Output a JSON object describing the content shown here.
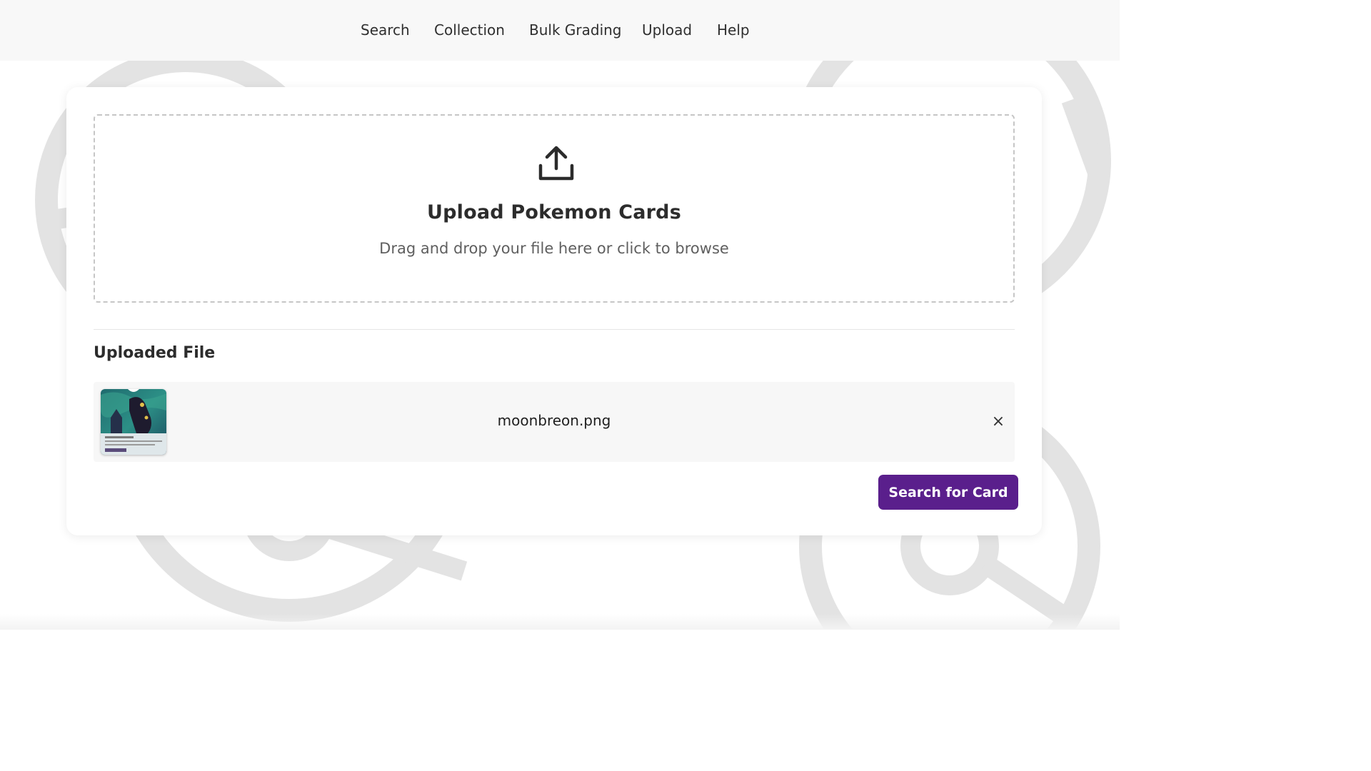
{
  "nav": {
    "items": [
      {
        "label": "Search"
      },
      {
        "label": "Collection"
      },
      {
        "label": "Bulk Grading"
      },
      {
        "label": "Upload"
      },
      {
        "label": "Help"
      }
    ]
  },
  "dropzone": {
    "icon": "upload-icon",
    "title": "Upload Pokemon Cards",
    "subtitle": "Drag and drop your file here or click to browse"
  },
  "uploaded": {
    "section_title": "Uploaded File",
    "file_name": "moonbreon.png",
    "remove_icon": "close-icon",
    "remove_label": "×"
  },
  "actions": {
    "search_button": "Search for Card"
  },
  "colors": {
    "accent": "#5a1f8c",
    "nav_bg": "#f8f8f8",
    "decor": "#e4e4e4"
  }
}
